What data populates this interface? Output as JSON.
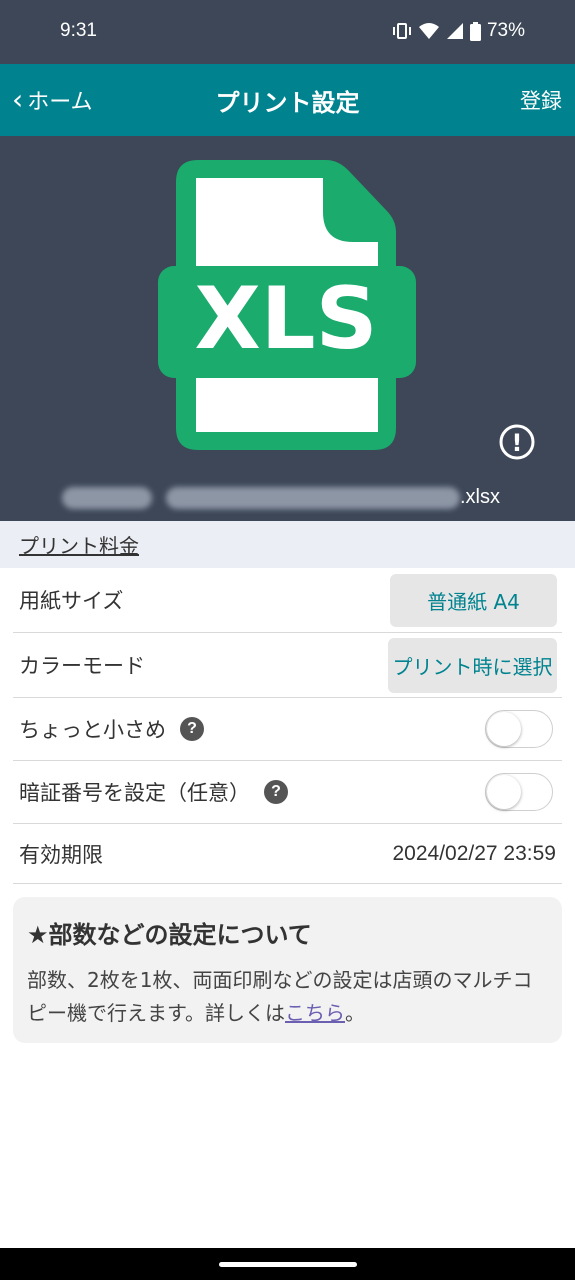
{
  "status": {
    "time": "9:31",
    "battery": "73%"
  },
  "nav": {
    "back_label": "ホーム",
    "back_chevron": "‹",
    "title": "プリント設定",
    "register_label": "登録"
  },
  "preview": {
    "file_type": "XLS",
    "file_ext": ".xlsx",
    "icon_color": "#1aab6d",
    "warning_glyph": "!"
  },
  "section": {
    "title": "プリント料金"
  },
  "settings": {
    "paper_size": {
      "label": "用紙サイズ",
      "value": "普通紙 A4"
    },
    "color_mode": {
      "label": "カラーモード",
      "value": "プリント時に選択"
    },
    "small": {
      "label": "ちょっと小さめ",
      "help": "?",
      "enabled": false
    },
    "pin": {
      "label": "暗証番号を設定（任意）",
      "help": "?",
      "enabled": false
    },
    "expiry": {
      "label": "有効期限",
      "value": "2024/02/27 23:59"
    }
  },
  "info": {
    "title": "★部数などの設定について",
    "text_before": "部数、2枚を1枚、両面印刷などの設定は店頭のマルチコピー機で行えます。詳しくは",
    "link": "こちら",
    "text_after": "。"
  }
}
